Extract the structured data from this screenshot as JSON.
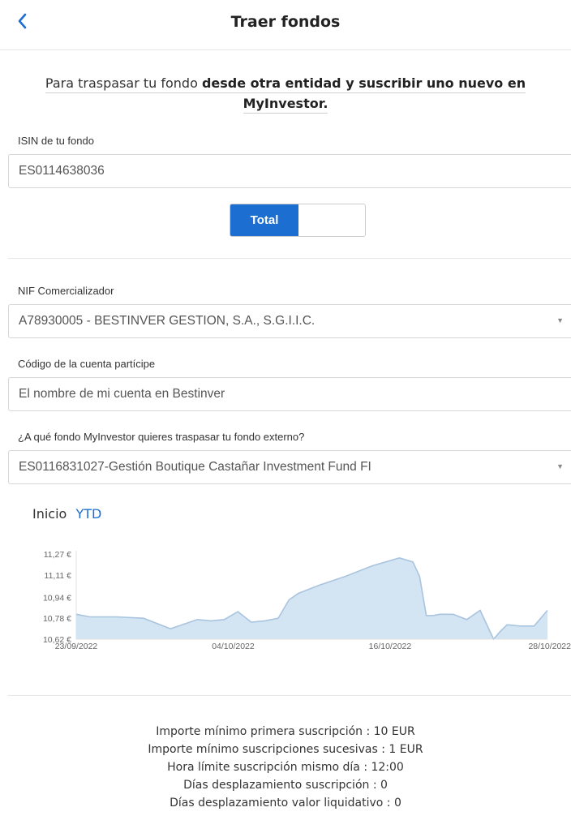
{
  "header": {
    "title": "Traer fondos"
  },
  "intro": {
    "text_plain": "Para traspasar tu fondo ",
    "text_bold_1": "desde otra entidad y suscribir uno nuevo en",
    "text_bold_2": "MyInvestor."
  },
  "isin": {
    "label": "ISIN de tu fondo",
    "value": "ES0114638036"
  },
  "transfer_type": {
    "selected": "Total"
  },
  "nif": {
    "label": "NIF Comercializador",
    "value": "A78930005 - BESTINVER GESTION, S.A., S.G.I.I.C."
  },
  "account_code": {
    "label": "Código de la cuenta partícipe",
    "value": "El nombre de mi cuenta en Bestinver"
  },
  "target_fund": {
    "label": "¿A qué fondo MyInvestor quieres traspasar tu fondo externo?",
    "value": "ES0116831027-Gestión Boutique Castañar Investment Fund FI"
  },
  "chart_tabs": {
    "inicio": "Inicio",
    "ytd": "YTD",
    "active": "YTD"
  },
  "chart_data": {
    "type": "area",
    "title": "",
    "xlabel": "",
    "ylabel": "",
    "ylim": [
      10.62,
      11.27
    ],
    "y_ticks": [
      "11,27 €",
      "11,11 €",
      "10,94 €",
      "10,78 €",
      "10,62 €"
    ],
    "y_tick_values": [
      11.27,
      11.11,
      10.94,
      10.78,
      10.62
    ],
    "x_ticks": [
      "23/09/2022",
      "04/10/2022",
      "16/10/2022",
      "28/10/2022"
    ],
    "x_range_days": [
      0,
      35
    ],
    "series": [
      {
        "color": "#a9c4df",
        "fill": "#d3e4f2",
        "x": [
          0,
          1,
          3,
          5,
          7,
          9,
          10,
          11,
          12,
          13,
          14,
          15,
          15.8,
          16.5,
          17,
          18,
          20,
          22,
          24,
          25,
          25.5,
          26,
          26.5,
          27,
          28,
          29,
          30,
          31,
          31.5,
          32,
          33,
          34,
          35
        ],
        "y": [
          10.81,
          10.79,
          10.79,
          10.78,
          10.7,
          10.77,
          10.76,
          10.77,
          10.83,
          10.75,
          10.76,
          10.78,
          10.92,
          10.97,
          10.99,
          11.03,
          11.1,
          11.18,
          11.24,
          11.21,
          11.1,
          10.8,
          10.8,
          10.81,
          10.81,
          10.77,
          10.84,
          10.62,
          10.68,
          10.73,
          10.72,
          10.72,
          10.84
        ]
      }
    ]
  },
  "info": {
    "lines": [
      "Importe mínimo primera suscripción : 10 EUR",
      "Importe mínimo suscripciones sucesivas : 1 EUR",
      "Hora límite suscripción mismo día : 12:00",
      "Días desplazamiento suscripción : 0",
      "Días desplazamiento valor liquidativo : 0"
    ]
  },
  "colors": {
    "accent": "#1c6ed0",
    "chart_fill": "#d3e4f2",
    "chart_line": "#a9c4df"
  }
}
